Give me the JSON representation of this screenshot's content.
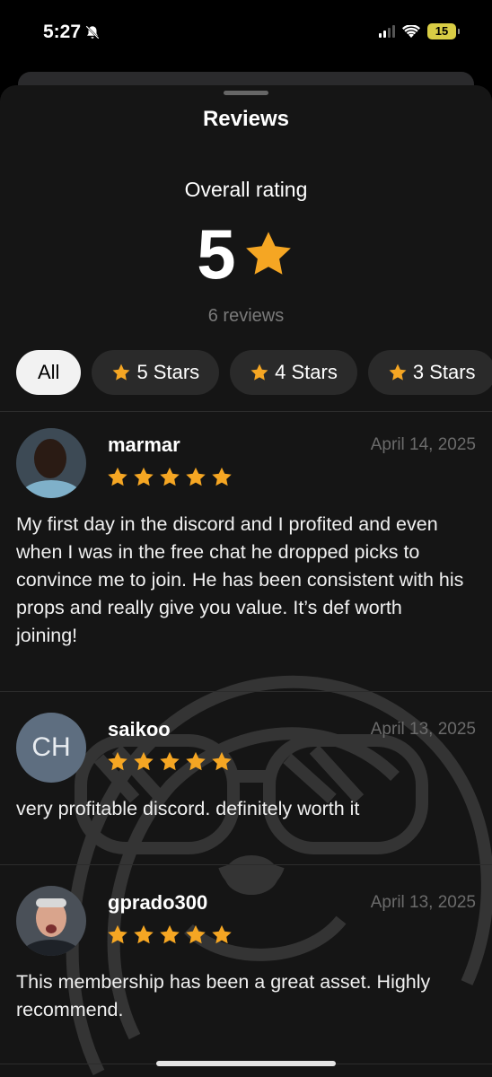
{
  "status_bar": {
    "time": "5:27",
    "battery": "15",
    "mute_icon": "bell-slash-icon",
    "wifi_icon": "wifi-icon",
    "signal_icon": "signal-bars-icon"
  },
  "sheet": {
    "title": "Reviews"
  },
  "summary": {
    "label": "Overall rating",
    "score": "5",
    "count": "6 reviews",
    "star_icon": "star-icon"
  },
  "filters": [
    {
      "label": "All",
      "active": true
    },
    {
      "label": "5 Stars",
      "icon": "star-icon"
    },
    {
      "label": "4 Stars",
      "icon": "star-icon"
    },
    {
      "label": "3 Stars",
      "icon": "star-icon"
    }
  ],
  "reviews": [
    {
      "name": "marmar",
      "date": "April 14, 2025",
      "rating": 5,
      "avatar": "photo",
      "text": "My first day in the discord and I profited and even when I was in the free chat he dropped picks to convince me to join. He has been consistent with his props and really give you value. It’s def worth joining!"
    },
    {
      "name": "saikoo",
      "date": "April 13, 2025",
      "rating": 5,
      "avatar_initials": "CH",
      "text": "very profitable discord. definitely worth it"
    },
    {
      "name": "gprado300",
      "date": "April 13, 2025",
      "rating": 5,
      "avatar": "photo",
      "text": "This membership has been a great asset. Highly recommend."
    }
  ],
  "colors": {
    "accent_star": "#f5a623",
    "background": "#151515",
    "chip": "#2a2a2a"
  }
}
